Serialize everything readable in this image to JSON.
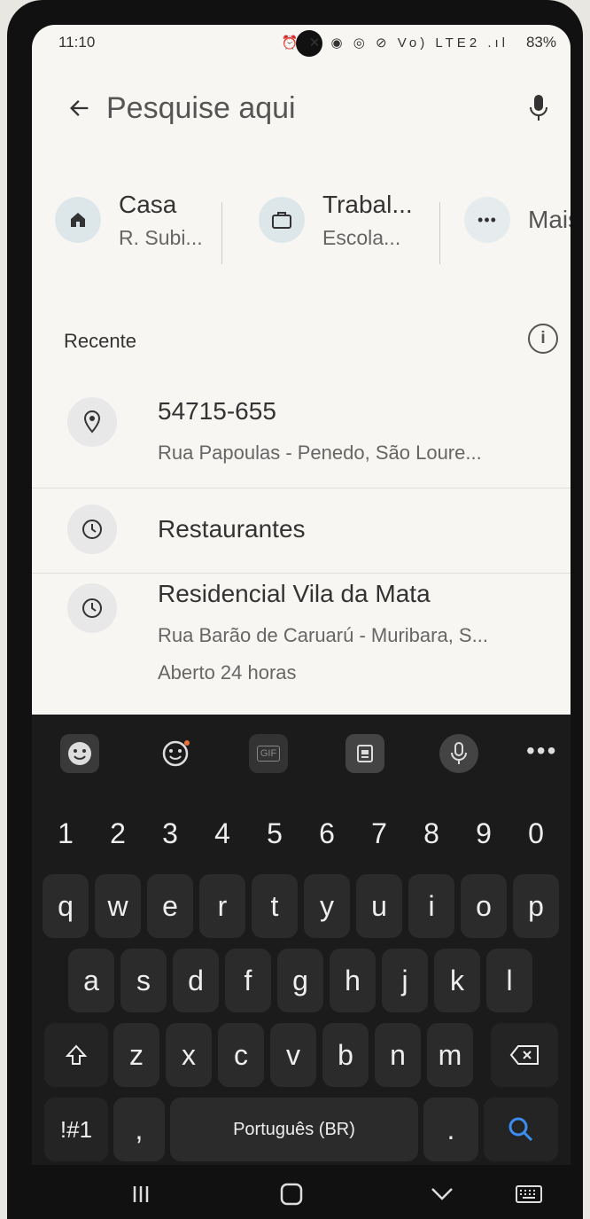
{
  "status_bar": {
    "time": "11:10",
    "icons": "⏰ ✕ ◉ ◎ ⊘ Vo) LTE2 .ıl",
    "battery": "83%"
  },
  "search": {
    "placeholder": "Pesquise aqui"
  },
  "shortcuts": [
    {
      "title": "Casa",
      "subtitle": "R. Subi..."
    },
    {
      "title": "Trabal...",
      "subtitle": "Escola..."
    },
    {
      "title": "Mais"
    }
  ],
  "recent": {
    "title": "Recente",
    "items": [
      {
        "line1": "54715-655",
        "line2": "Rua Papoulas - Penedo, São Loure..."
      },
      {
        "line1": "Restaurantes"
      },
      {
        "line1": "Residencial Vila da Mata",
        "line2": "Rua Barão de Caruarú - Muribara, S...",
        "line3": "Aberto 24 horas"
      }
    ]
  },
  "keyboard": {
    "row_numbers": [
      "1",
      "2",
      "3",
      "4",
      "5",
      "6",
      "7",
      "8",
      "9",
      "0"
    ],
    "row1": [
      "q",
      "w",
      "e",
      "r",
      "t",
      "y",
      "u",
      "i",
      "o",
      "p"
    ],
    "row2": [
      "a",
      "s",
      "d",
      "f",
      "g",
      "h",
      "j",
      "k",
      "l"
    ],
    "row3": [
      "z",
      "x",
      "c",
      "v",
      "b",
      "n",
      "m"
    ],
    "symbols_key": "!#1",
    "comma_key": ",",
    "space_label": "Português (BR)",
    "period_key": ".",
    "more_label": "•••"
  }
}
